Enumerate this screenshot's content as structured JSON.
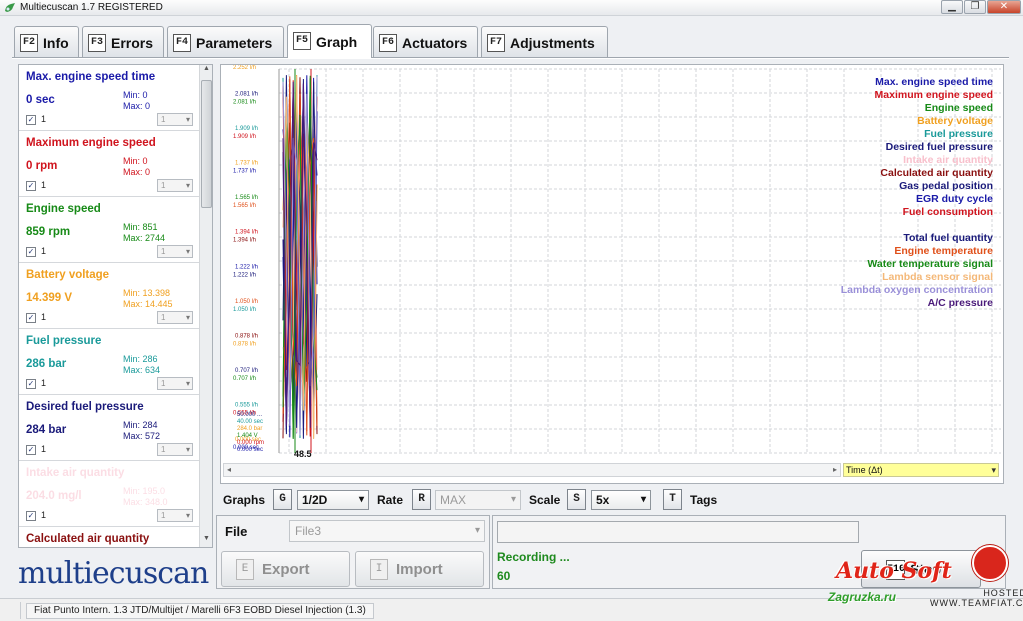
{
  "window": {
    "title": "Multiecuscan 1.7 REGISTERED",
    "minimize": "▁",
    "maximize": "❐",
    "close": "✕"
  },
  "tabs": [
    {
      "key": "F2",
      "label": "Info"
    },
    {
      "key": "F3",
      "label": "Errors"
    },
    {
      "key": "F4",
      "label": "Parameters"
    },
    {
      "key": "F5",
      "label": "Graph"
    },
    {
      "key": "F6",
      "label": "Actuators"
    },
    {
      "key": "F7",
      "label": "Adjustments"
    }
  ],
  "active_tab": "Graph",
  "parameters": [
    {
      "name": "Max. engine speed time",
      "value": "0 sec",
      "min": "Min: 0",
      "max": "Max: 0",
      "check": "✓",
      "scale": "1",
      "sel": "1",
      "color": "#1a1aa8"
    },
    {
      "name": "Maximum engine speed",
      "value": "0 rpm",
      "min": "Min: 0",
      "max": "Max: 0",
      "check": "✓",
      "scale": "1",
      "sel": "1",
      "color": "#d0141e"
    },
    {
      "name": "Engine speed",
      "value": "859 rpm",
      "min": "Min: 851",
      "max": "Max: 2744",
      "check": "✓",
      "scale": "1",
      "sel": "1",
      "color": "#178a17"
    },
    {
      "name": "Battery voltage",
      "value": "14.399 V",
      "min": "Min: 13.398",
      "max": "Max: 14.445",
      "check": "✓",
      "scale": "1",
      "sel": "1",
      "color": "#f0a020"
    },
    {
      "name": "Fuel pressure",
      "value": "286 bar",
      "min": "Min: 286",
      "max": "Max: 634",
      "check": "✓",
      "scale": "1",
      "sel": "1",
      "color": "#1a9a9a"
    },
    {
      "name": "Desired fuel pressure",
      "value": "284 bar",
      "min": "Min: 284",
      "max": "Max: 572",
      "check": "✓",
      "scale": "1",
      "sel": "1",
      "color": "#1a1a7a"
    },
    {
      "name": "Intake air quantity",
      "value": "204.0 mg/l",
      "min": "Min: 195.0",
      "max": "Max: 348.0",
      "check": "✓",
      "scale": "1",
      "sel": "1",
      "color": "#f4a0b4"
    },
    {
      "name": "Calculated air quantity",
      "value": "",
      "min": "",
      "max": "",
      "check": "",
      "scale": "",
      "sel": "",
      "color": "#8a1010"
    }
  ],
  "legend": [
    {
      "label": "Max. engine speed time",
      "color": "#1a1aa8"
    },
    {
      "label": "Maximum engine speed",
      "color": "#d0141e"
    },
    {
      "label": "Engine speed",
      "color": "#178a17"
    },
    {
      "label": "Battery voltage",
      "color": "#f0a020"
    },
    {
      "label": "Fuel pressure",
      "color": "#1a9a9a"
    },
    {
      "label": "Desired fuel pressure",
      "color": "#1a1a7a"
    },
    {
      "label": "Intake air quantity",
      "color": "#f8c0cc"
    },
    {
      "label": "Calculated air quantity",
      "color": "#8a1010"
    },
    {
      "label": "Gas pedal position",
      "color": "#1a1a7a"
    },
    {
      "label": "EGR duty cycle",
      "color": "#1a1aa8"
    },
    {
      "label": "Fuel consumption",
      "color": "#d0141e"
    },
    {
      "label": "",
      "color": "#ffffff"
    },
    {
      "label": "Total fuel quantity",
      "color": "#1a1a7a"
    },
    {
      "label": "Engine temperature",
      "color": "#e0501a"
    },
    {
      "label": "Water temperature signal",
      "color": "#178a17"
    },
    {
      "label": "Lambda sensor signal",
      "color": "#f4b878"
    },
    {
      "label": "Lambda oxygen concentration",
      "color": "#9a90d8"
    },
    {
      "label": "A/C pressure",
      "color": "#4a1a7a"
    }
  ],
  "graph": {
    "cursor_label": "48.5",
    "time_axis": "Time (Δt)",
    "scroll_left": "◂",
    "scroll_right": "▸",
    "axis_ticks_bottom": [
      "0.000 sec",
      "0.000 rpm",
      "1.404 V",
      "284.0 bar",
      "40.00 sec",
      "50.000 ..."
    ],
    "axis_ticks_mid": [
      "0.000 sec",
      "0.555 l/h",
      "0.707 l/h",
      "0.878 l/h",
      "1.050 l/h",
      "1.222 l/h",
      "1.394 l/h",
      "1.565 l/h",
      "1.737 l/h",
      "1.909 l/h",
      "2.081 l/h",
      "2.252 l/h"
    ]
  },
  "controls": {
    "graphs_label": "Graphs",
    "graphs_key": "G",
    "graphs_value": "1/2D",
    "rate_label": "Rate",
    "rate_key": "R",
    "rate_value": "MAX",
    "scale_label": "Scale",
    "scale_key": "S",
    "scale_value": "5x",
    "tags_key": "T",
    "tags_label": "Tags"
  },
  "file": {
    "label": "File",
    "value": "File3",
    "export_key": "E",
    "export_label": "Export",
    "import_key": "I",
    "import_label": "Import"
  },
  "recording": {
    "status": "Recording ...",
    "count": "60",
    "stop_key": "F10",
    "stop_label": "Stop"
  },
  "logo": "multiecuscan",
  "status": {
    "vehicle": "Fiat Punto Intern. 1.3 JTD/Multijet / Marelli 6F3 EOBD Diesel Injection (1.3)"
  },
  "watermark": {
    "brand": "Auto Soft",
    "sub": "Zagruzka.ru",
    "hosted": "HOSTED ON",
    "site": "WWW.TEAMFIAT.CO.IN"
  }
}
